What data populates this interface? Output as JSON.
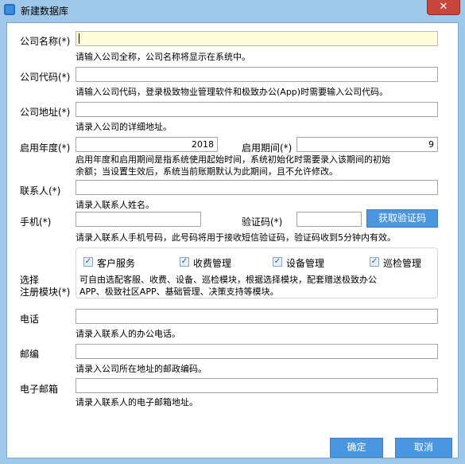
{
  "window": {
    "title": "新建数据库",
    "close_label": "✕"
  },
  "fields": {
    "company_name": {
      "label": "公司名称(*)",
      "value": "",
      "hint": "请输入公司全称，公司名称将显示在系统中。"
    },
    "company_code": {
      "label": "公司代码(*)",
      "value": "",
      "hint": "请输入公司代码，登录极致物业管理软件和极致办公(App)时需要输入公司代码。"
    },
    "company_address": {
      "label": "公司地址(*)",
      "value": "",
      "hint": "请录入公司的详细地址。"
    },
    "start_year": {
      "label": "启用年度(*)",
      "value": "2018"
    },
    "start_period": {
      "label": "启用期间(*)",
      "value": "9"
    },
    "period_hint_line1": "启用年度和启用期间是指系统使用起始时间，系统初始化时需要录入该期间的初始",
    "period_hint_line2": "余额；当设置生效后，系统当前账期默认为此期间，且不允许修改。",
    "contact": {
      "label": "联系人(*)",
      "value": "",
      "hint": "请录入联系人姓名。"
    },
    "mobile": {
      "label": "手机(*)",
      "value": "",
      "hint": "请录入联系人手机号码，此号码将用于接收短信验证码，验证码收到5分钟内有效。"
    },
    "verify_code": {
      "label": "验证码(*)",
      "value": "",
      "button": "获取验证码"
    },
    "modules": {
      "label_line1": "选择",
      "label_line2": "注册模块(*)",
      "options": [
        {
          "label": "客户服务",
          "checked": true
        },
        {
          "label": "收费管理",
          "checked": true
        },
        {
          "label": "设备管理",
          "checked": true
        },
        {
          "label": "巡检管理",
          "checked": true
        }
      ],
      "hint_line1": "可自由选配客服、收费、设备、巡检模块，根据选择模块，配套赠送极致办公",
      "hint_line2": "APP、极致社区APP、基础管理、决策支持等模块。"
    },
    "phone": {
      "label": "电话",
      "value": "",
      "hint": "请录入联系人的办公电话。"
    },
    "postcode": {
      "label": "邮编",
      "value": "",
      "hint": "请录入公司所在地址的邮政编码。"
    },
    "email": {
      "label": "电子邮箱",
      "value": "",
      "hint": "请录入联系人的电子邮箱地址。"
    }
  },
  "buttons": {
    "ok": "确定",
    "cancel": "取消"
  },
  "colors": {
    "frame": "#9fc7ea",
    "accent_button": "#4a97e0",
    "focused_input": "#fffbdb",
    "close_button": "#c9463d"
  }
}
